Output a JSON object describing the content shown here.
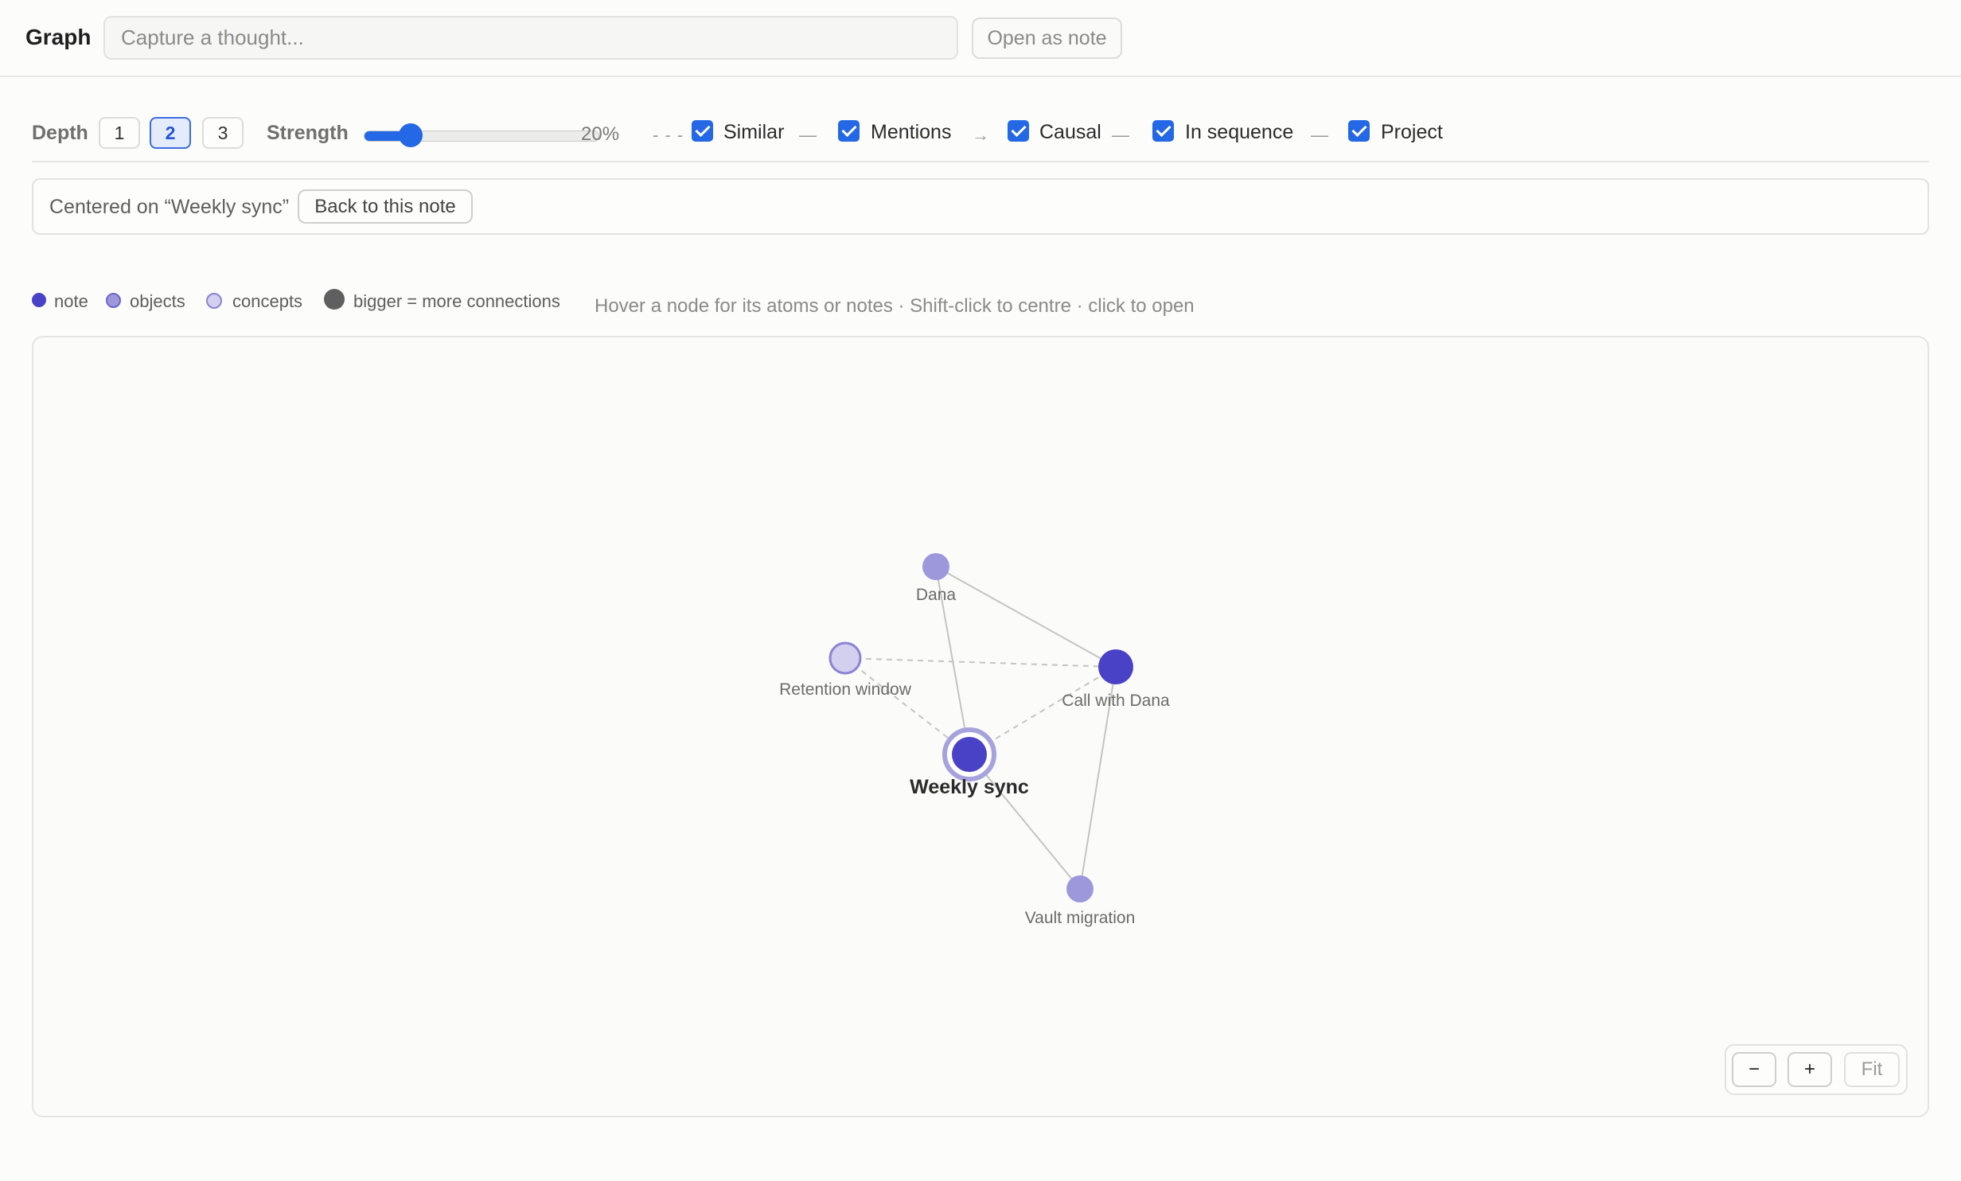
{
  "header": {
    "title": "Graph",
    "capture_placeholder": "Capture a thought...",
    "open_as_note_label": "Open as note"
  },
  "controls": {
    "depth_label": "Depth",
    "depth_options": [
      "1",
      "2",
      "3"
    ],
    "depth_selected": "2",
    "strength_label": "Strength",
    "strength_value": "20%",
    "strength_fraction": 0.2,
    "relations": [
      {
        "line_icon": "- - -",
        "label": "Similar",
        "checked": true
      },
      {
        "line_icon": "—",
        "label": "Mentions",
        "checked": true
      },
      {
        "line_icon": "→",
        "label": "Causal",
        "checked": true
      },
      {
        "line_icon": "—",
        "label": "In sequence",
        "checked": true
      },
      {
        "line_icon": "—",
        "label": "Project",
        "checked": true
      }
    ]
  },
  "centered": {
    "text": "Centered on “Weekly sync”",
    "back_label": "Back to this note"
  },
  "legend": {
    "items": [
      {
        "label": "note",
        "color": "#4a42c6"
      },
      {
        "label": "objects",
        "color": "#9d98dc"
      },
      {
        "label": "concepts",
        "color": "#d2cfef"
      },
      {
        "label": "bigger = more connections",
        "color": "#5f5f5f"
      }
    ],
    "hint": "Hover a node for its atoms or notes · Shift-click to centre · click to open"
  },
  "graph": {
    "colors": {
      "note": "#4a42c6",
      "object": "#9d98dc",
      "concept": "#d2cfef",
      "concept_border": "#8a84d2",
      "center_ring": "#a6a2dc",
      "edge": "#c4c4c1"
    },
    "nodes": [
      {
        "id": "dana",
        "label": "Dana",
        "kind": "object",
        "center": false
      },
      {
        "id": "retention",
        "label": "Retention window",
        "kind": "concept",
        "center": false
      },
      {
        "id": "call",
        "label": "Call with Dana",
        "kind": "note",
        "center": false
      },
      {
        "id": "weekly",
        "label": "Weekly sync",
        "kind": "note",
        "center": true
      },
      {
        "id": "vault",
        "label": "Vault migration",
        "kind": "object",
        "center": false
      }
    ],
    "edges": [
      {
        "from": "dana",
        "to": "call",
        "style": "solid"
      },
      {
        "from": "dana",
        "to": "weekly",
        "style": "solid"
      },
      {
        "from": "retention",
        "to": "call",
        "style": "dashed"
      },
      {
        "from": "retention",
        "to": "weekly",
        "style": "dashed"
      },
      {
        "from": "call",
        "to": "weekly",
        "style": "dashed"
      },
      {
        "from": "call",
        "to": "vault",
        "style": "solid"
      },
      {
        "from": "weekly",
        "to": "vault",
        "style": "solid"
      }
    ]
  },
  "zoom": {
    "minus_label": "−",
    "plus_label": "+",
    "fit_label": "Fit"
  }
}
